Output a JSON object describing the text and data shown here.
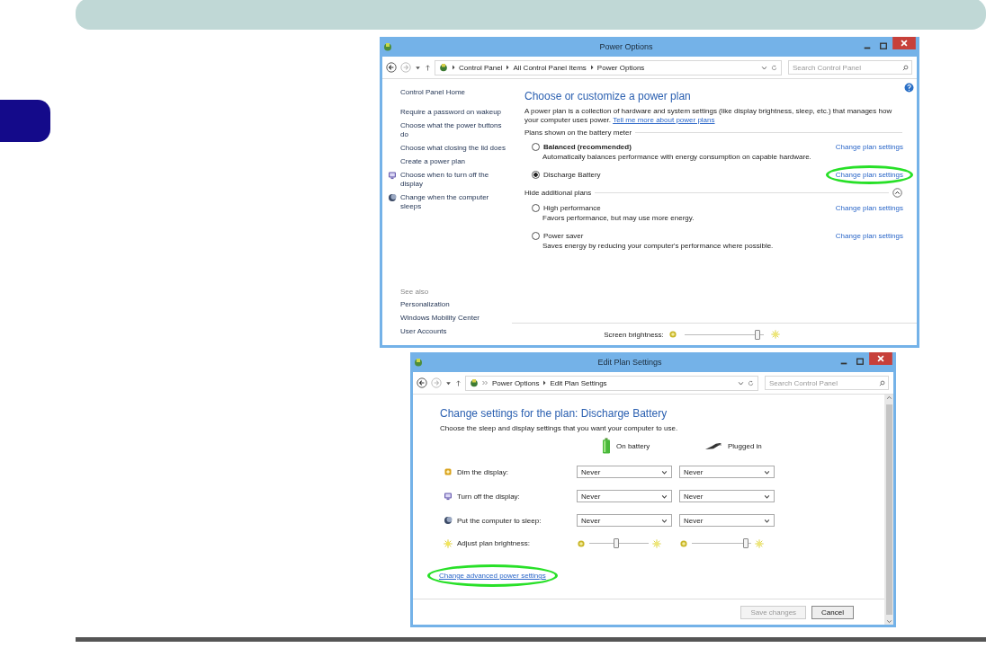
{
  "power_options_window": {
    "title": "Power Options",
    "breadcrumbs": [
      "Control Panel",
      "All Control Panel Items",
      "Power Options"
    ],
    "search": {
      "placeholder": "Search Control Panel"
    },
    "sidebar": {
      "items": [
        {
          "label": "Control Panel Home",
          "kind": "plain"
        },
        {
          "label": "Require a password on wakeup",
          "kind": "plain"
        },
        {
          "label": "Choose what the power buttons do",
          "kind": "plain"
        },
        {
          "label": "Choose what closing the lid does",
          "kind": "plain"
        },
        {
          "label": "Create a power plan",
          "kind": "plain"
        },
        {
          "label": "Choose when to turn off the display",
          "kind": "display"
        },
        {
          "label": "Change when the computer sleeps",
          "kind": "sleep"
        }
      ],
      "see_also_label": "See also",
      "see_also": [
        "Personalization",
        "Windows Mobility Center",
        "User Accounts"
      ]
    },
    "heading": "Choose or customize a power plan",
    "description": "A power plan is a collection of hardware and system settings (like display brightness, sleep, etc.) that manages how your computer uses power.",
    "description_link": "Tell me more about power plans",
    "plans_label": "Plans shown on the battery meter",
    "plans": [
      {
        "name": "Balanced (recommended)",
        "emphasized": true,
        "selected": false,
        "description": "Automatically balances performance with energy consumption on capable hardware.",
        "link": "Change plan settings",
        "highlighted": false
      },
      {
        "name": "Discharge Battery",
        "emphasized": false,
        "selected": true,
        "link": "Change plan settings",
        "highlighted": true
      }
    ],
    "additional_label": "Hide additional plans",
    "additional_expanded": true,
    "additional_plans": [
      {
        "name": "High performance",
        "emphasized": false,
        "selected": false,
        "description": "Favors performance, but may use more energy.",
        "link": "Change plan settings",
        "highlighted": false
      },
      {
        "name": "Power saver",
        "emphasized": false,
        "selected": false,
        "description": "Saves energy by reducing your computer's performance where possible.",
        "link": "Change plan settings",
        "highlighted": false
      }
    ],
    "brightness": {
      "label": "Screen brightness:",
      "level": 0.95
    }
  },
  "edit_plan_window": {
    "title": "Edit Plan Settings",
    "breadcrumbs": [
      "Power Options",
      "Edit Plan Settings"
    ],
    "search": {
      "placeholder": "Search Control Panel"
    },
    "heading": "Change settings for the plan: Discharge Battery",
    "description": "Choose the sleep and display settings that you want your computer to use.",
    "columns": [
      {
        "label": "On battery"
      },
      {
        "label": "Plugged in"
      }
    ],
    "settings": [
      {
        "label": "Dim the display:",
        "kind": "dropdown",
        "values": [
          "Never",
          "Never"
        ]
      },
      {
        "label": "Turn off the display:",
        "kind": "dropdown",
        "values": [
          "Never",
          "Never"
        ]
      },
      {
        "label": "Put the computer to sleep:",
        "kind": "dropdown",
        "values": [
          "Never",
          "Never"
        ]
      },
      {
        "label": "Adjust plan brightness:",
        "kind": "slider",
        "levels": [
          {
            "level": 0.45
          },
          {
            "level": 0.95
          }
        ]
      }
    ],
    "advanced_link": {
      "label": "Change advanced power settings",
      "highlighted": true
    },
    "buttons": [
      {
        "label": "Save changes",
        "disabled": true
      },
      {
        "label": "Cancel",
        "disabled": false
      }
    ]
  }
}
